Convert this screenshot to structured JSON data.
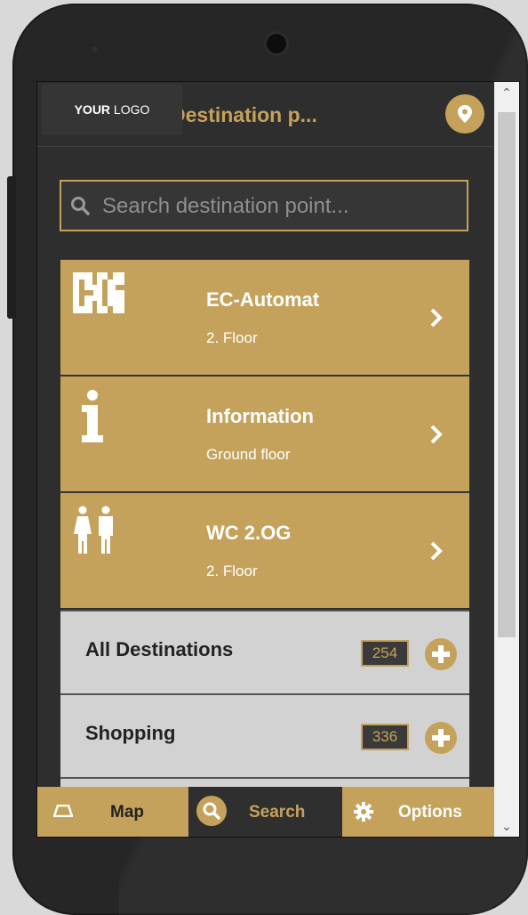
{
  "logo": {
    "strong": "YOUR",
    "rest": " LOGO"
  },
  "header": {
    "title": "Destination p..."
  },
  "search": {
    "placeholder": "Search destination point..."
  },
  "destinations": [
    {
      "title": "EC-Automat",
      "floor": "2. Floor",
      "icon": "ec-automat-icon"
    },
    {
      "title": "Information",
      "floor": "Ground floor",
      "icon": "information-icon"
    },
    {
      "title": "WC 2.OG",
      "floor": "2. Floor",
      "icon": "restroom-icon"
    }
  ],
  "categories": [
    {
      "label": "All Destinations",
      "count": "254"
    },
    {
      "label": "Shopping",
      "count": "336"
    }
  ],
  "nav": {
    "map": "Map",
    "search": "Search",
    "options": "Options"
  },
  "colors": {
    "accent": "#c5a25b",
    "dark": "#2e2e2e",
    "light": "#d2d2d2"
  }
}
